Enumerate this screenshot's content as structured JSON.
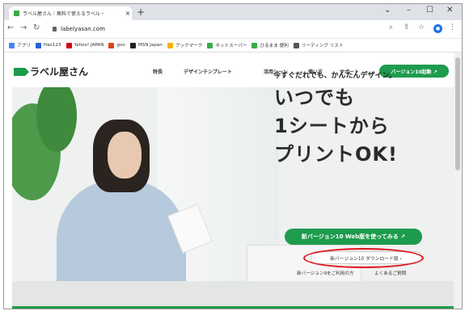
{
  "browser": {
    "tab_title": "ラベル屋さん｜無料で使えるラベル・",
    "tab_close": "×",
    "new_tab": "+",
    "url": "labelyasan.com",
    "profile_initial": "●",
    "bookmarks": [
      {
        "label": "アプリ",
        "color": "#4285f4"
      },
      {
        "label": "Hao123",
        "color": "#2a62d6"
      },
      {
        "label": "Yahoo! JAPAN",
        "color": "#d6001c"
      },
      {
        "label": "goo",
        "color": "#e0431b"
      },
      {
        "label": "MSN Japan",
        "color": "#222222"
      },
      {
        "label": "ブックマーク",
        "color": "#f2b400"
      },
      {
        "label": "ネットスーパー",
        "color": "#3aaa4a"
      },
      {
        "label": "ひるまま 便利",
        "color": "#3aaa4a"
      },
      {
        "label": "リーディング リスト",
        "color": "#555555"
      }
    ]
  },
  "site": {
    "logo": "ラベル屋さん",
    "nav": [
      "特長",
      "デザインテンプレート",
      "活用シーン",
      "使い方",
      "サポート"
    ],
    "cta": "バージョン10起動 ↗",
    "tagline": "今すぐだれでも、かんたんデザイン。",
    "headline": [
      "いつでも",
      "1シートから",
      "プリントOK!"
    ],
    "web_button": "新バージョン10 Web版を使ってみる ↗",
    "download_button": "新バージョン10 ダウンロード版 ›",
    "sub_links": [
      "新バージョン9をご利用の方",
      "よくあるご質問"
    ],
    "accent": "#1e9b4d",
    "highlight": "#e0101a"
  }
}
